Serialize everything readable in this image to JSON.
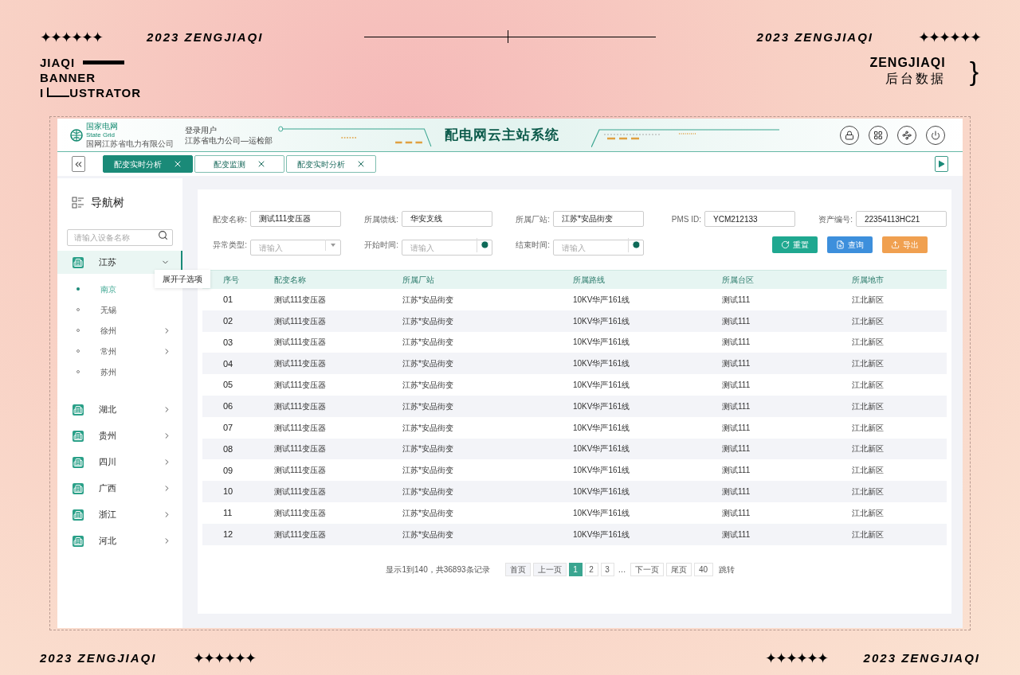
{
  "banner": {
    "stars_left": "✦✦✦✦✦✦",
    "year_left": "2023 ZENGJIAQI",
    "year_right": "2023 ZENGJIAQI",
    "stars_right": "✦✦✦✦✦✦",
    "brand_lines": [
      "JIAQI",
      "BANNER"
    ],
    "brand_last": [
      "I",
      "USTRATOR"
    ],
    "side_title": "ZENGJIAQI",
    "side_subtitle": "后台数据",
    "brace": "}"
  },
  "footer": {
    "year_left": "2023 ZENGJIAQI",
    "stars_left": "✦✦✦✦✦✦",
    "stars_right": "✦✦✦✦✦✦",
    "year_right": "2023 ZENGJIAQI"
  },
  "header": {
    "logo_name": "国家电网",
    "logo_en": "State Grid",
    "logo_company": "国网江苏省电力有限公司",
    "user_label": "登录用户",
    "user_org": "江苏省电力公司—运检部",
    "title": "配电网云主站系统"
  },
  "tabs": [
    {
      "label": "配变实时分析",
      "selected": true
    },
    {
      "label": "配变监测",
      "selected": false
    },
    {
      "label": "配变实时分析",
      "selected": false
    }
  ],
  "sidebar": {
    "title": "导航树",
    "search_placeholder": "请输入设备名称",
    "tooltip": "展开子选项",
    "items": [
      {
        "label": "江苏",
        "expanded": true,
        "selected": true,
        "children": [
          {
            "label": "南京",
            "selected": true,
            "expandable": false
          },
          {
            "label": "无锡",
            "selected": false,
            "expandable": false
          },
          {
            "label": "徐州",
            "selected": false,
            "expandable": true
          },
          {
            "label": "常州",
            "selected": false,
            "expandable": true
          },
          {
            "label": "苏州",
            "selected": false,
            "expandable": false
          }
        ]
      },
      {
        "label": "湖北",
        "expanded": false,
        "selected": false
      },
      {
        "label": "贵州",
        "expanded": false,
        "selected": false
      },
      {
        "label": "四川",
        "expanded": false,
        "selected": false
      },
      {
        "label": "广西",
        "expanded": false,
        "selected": false
      },
      {
        "label": "浙江",
        "expanded": false,
        "selected": false
      },
      {
        "label": "河北",
        "expanded": false,
        "selected": false
      }
    ]
  },
  "filters": [
    {
      "label": "配变名称:",
      "kind": "text",
      "value": "测试111变压器"
    },
    {
      "label": "所属馈线:",
      "kind": "text",
      "value": "华安支线"
    },
    {
      "label": "所属厂站:",
      "kind": "text",
      "value": "江苏*安品街变"
    },
    {
      "label": "PMS ID:",
      "kind": "text",
      "value": "YCM212133"
    },
    {
      "label": "资产编号:",
      "kind": "text",
      "value": "22354113HC21"
    },
    {
      "label": "异常类型:",
      "kind": "select",
      "placeholder": "请输入"
    },
    {
      "label": "开始时间:",
      "kind": "time",
      "placeholder": "请输入"
    },
    {
      "label": "结束时间:",
      "kind": "time",
      "placeholder": "请输入"
    }
  ],
  "actions": [
    {
      "label": "重置",
      "kind": "reset",
      "color": "#1fa890"
    },
    {
      "label": "查询",
      "kind": "search",
      "color": "#3d8fdc"
    },
    {
      "label": "导出",
      "kind": "export",
      "color": "#f0a050"
    }
  ],
  "table": {
    "columns": [
      "序号",
      "配变名称",
      "所属厂站",
      "所属路线",
      "所属台区",
      "所属地市"
    ],
    "rows": [
      [
        "01",
        "测试111变压器",
        "江苏*安品街变",
        "10KV华严161线",
        "测试111",
        "江北新区"
      ],
      [
        "02",
        "测试111变压器",
        "江苏*安品街变",
        "10KV华严161线",
        "测试111",
        "江北新区"
      ],
      [
        "03",
        "测试111变压器",
        "江苏*安品街变",
        "10KV华严161线",
        "测试111",
        "江北新区"
      ],
      [
        "04",
        "测试111变压器",
        "江苏*安品街变",
        "10KV华严161线",
        "测试111",
        "江北新区"
      ],
      [
        "05",
        "测试111变压器",
        "江苏*安品街变",
        "10KV华严161线",
        "测试111",
        "江北新区"
      ],
      [
        "06",
        "测试111变压器",
        "江苏*安品街变",
        "10KV华严161线",
        "测试111",
        "江北新区"
      ],
      [
        "07",
        "测试111变压器",
        "江苏*安品街变",
        "10KV华严161线",
        "测试111",
        "江北新区"
      ],
      [
        "08",
        "测试111变压器",
        "江苏*安品街变",
        "10KV华严161线",
        "测试111",
        "江北新区"
      ],
      [
        "09",
        "测试111变压器",
        "江苏*安品街变",
        "10KV华严161线",
        "测试111",
        "江北新区"
      ],
      [
        "10",
        "测试111变压器",
        "江苏*安品街变",
        "10KV华严161线",
        "测试111",
        "江北新区"
      ],
      [
        "11",
        "测试111变压器",
        "江苏*安品街变",
        "10KV华严161线",
        "测试111",
        "江北新区"
      ],
      [
        "12",
        "测试111变压器",
        "江苏*安品街变",
        "10KV华严161线",
        "测试111",
        "江北新区"
      ]
    ]
  },
  "pagination": {
    "summary": "显示1到140，共36893条记录",
    "first": "首页",
    "prev": "上一页",
    "pages": [
      {
        "label": "1",
        "selected": true
      },
      {
        "label": "2",
        "selected": false
      },
      {
        "label": "3",
        "selected": false
      }
    ],
    "ellipsis": "…",
    "next": "下一页",
    "last": "尾页",
    "jump_value": "40",
    "jump": "跳转"
  }
}
